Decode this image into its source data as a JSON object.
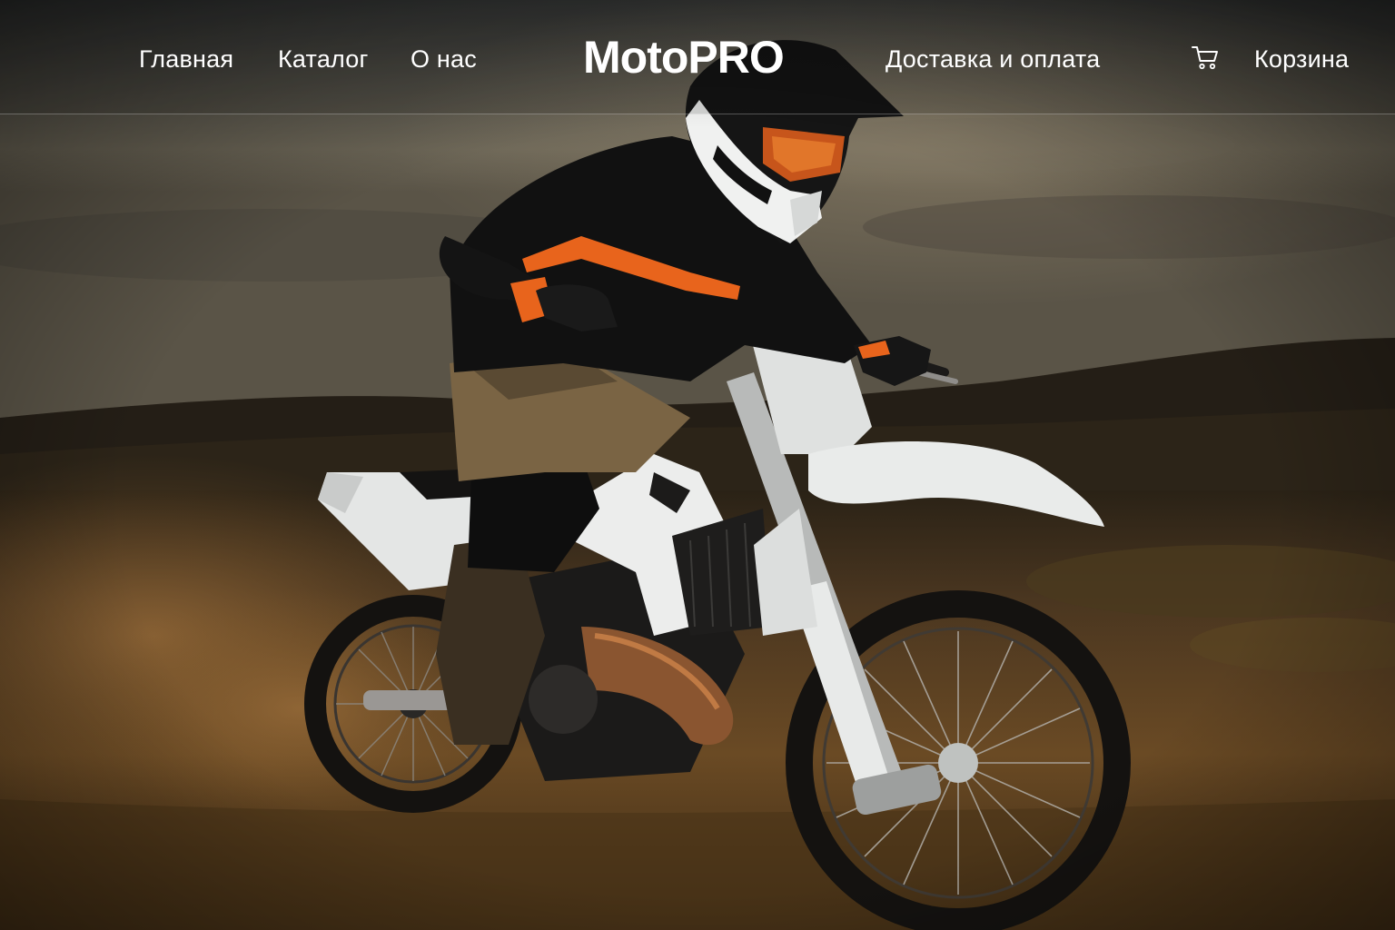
{
  "header": {
    "nav_left": [
      {
        "label": "Главная"
      },
      {
        "label": "Каталог"
      },
      {
        "label": "О нас"
      }
    ],
    "logo": "MotoPRO",
    "nav_right": [
      {
        "label": "Доставка и оплата"
      }
    ],
    "cart": {
      "icon": "cart-icon",
      "label": "Корзина"
    }
  },
  "hero": {
    "image": "dirt-bike-rider-photo"
  },
  "colors": {
    "text": "#ffffff",
    "accent_orange": "#e8641c",
    "bike_white": "#e9ebea",
    "sky": "#5f5a50",
    "ground": "#6a4a24"
  }
}
